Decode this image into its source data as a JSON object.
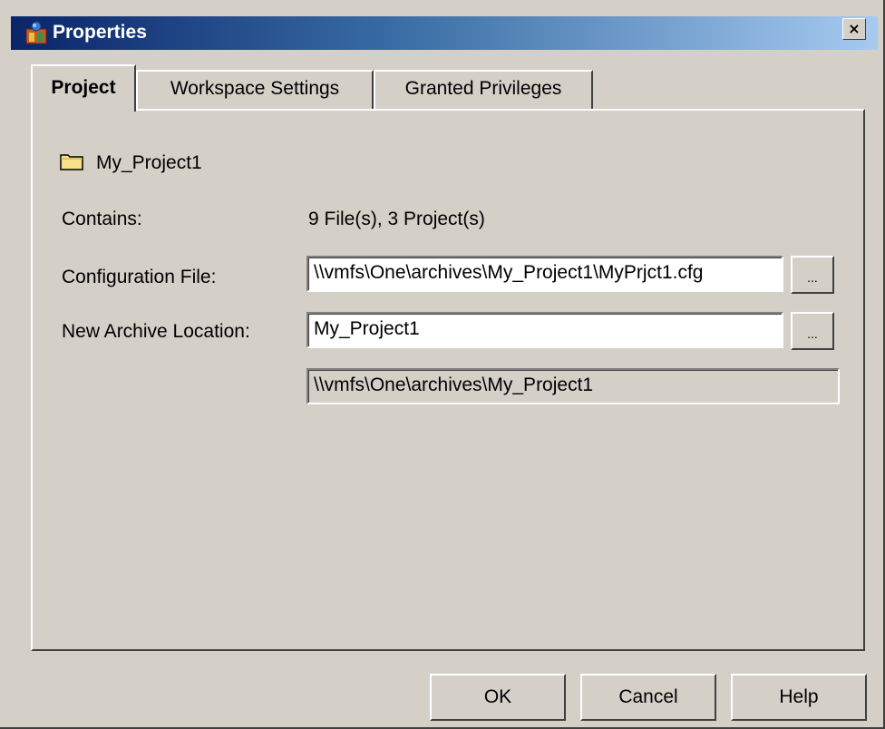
{
  "window": {
    "title": "Properties",
    "close_label": "×"
  },
  "tabs": [
    {
      "label": "Project",
      "active": true
    },
    {
      "label": "Workspace Settings",
      "active": false
    },
    {
      "label": "Granted Privileges",
      "active": false
    }
  ],
  "project": {
    "name": "My_Project1",
    "icon": "folder-icon",
    "contains_label": "Contains:",
    "contains_value": "9 File(s), 3 Project(s)",
    "config_label": "Configuration File:",
    "config_value": "\\\\vmfs\\One\\archives\\My_Project1\\MyPrjct1.cfg",
    "config_browse": "...",
    "archive_label": "New Archive Location:",
    "archive_value": "My_Project1",
    "archive_browse": "...",
    "archive_resolved": "\\\\vmfs\\One\\archives\\My_Project1"
  },
  "buttons": {
    "ok": "OK",
    "cancel": "Cancel",
    "help": "Help"
  },
  "colors": {
    "face": "#d4d0c8",
    "title_start": "#0a246a",
    "title_end": "#a6caf0",
    "folder": "#f8e08a"
  }
}
